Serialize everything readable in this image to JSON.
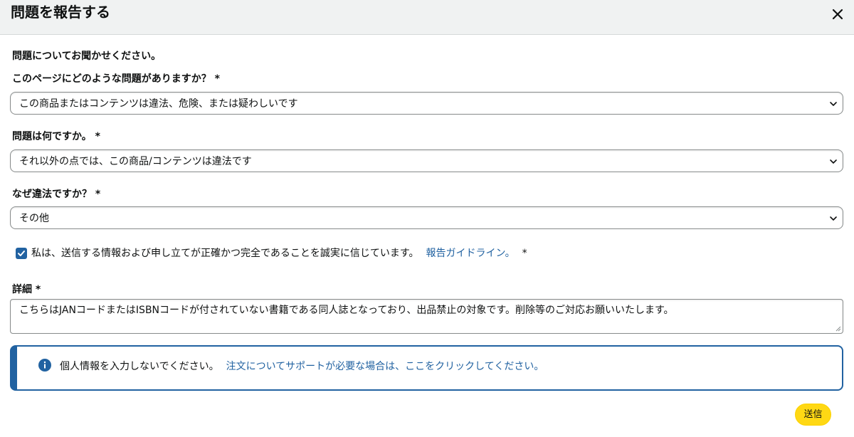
{
  "header": {
    "title": "問題を報告する"
  },
  "form": {
    "intro": "問題についてお聞かせください。",
    "q1": {
      "label": "このページにどのような問題がありますか？ *",
      "selected": "この商品またはコンテンツは違法、危険、または疑わしいです"
    },
    "q2": {
      "label": "問題は何ですか。 *",
      "selected": "それ以外の点では、この商品/コンテンツは違法です"
    },
    "q3": {
      "label": "なぜ違法ですか？ *",
      "selected": "その他"
    },
    "consent": {
      "checked": true,
      "text": "私は、送信する情報および申し立てが正確かつ完全であることを誠実に信じています。",
      "link": "報告ガイドライン。",
      "required": "*"
    },
    "details": {
      "label": "詳細 *",
      "value": "こちらはJANコードまたはISBNコードが付されていない書籍である同人誌となっており、出品禁止の対象です。削除等のご対応お願いいたします。"
    },
    "notice": {
      "text": "個人情報を入力しないでください。",
      "link": "注文についてサポートが必要な場合は、ここをクリックしてください。"
    },
    "submit_label": "送信"
  },
  "colors": {
    "accent": "#2162a1",
    "button": "#ffd814",
    "header_bg": "#f0f2f2"
  }
}
